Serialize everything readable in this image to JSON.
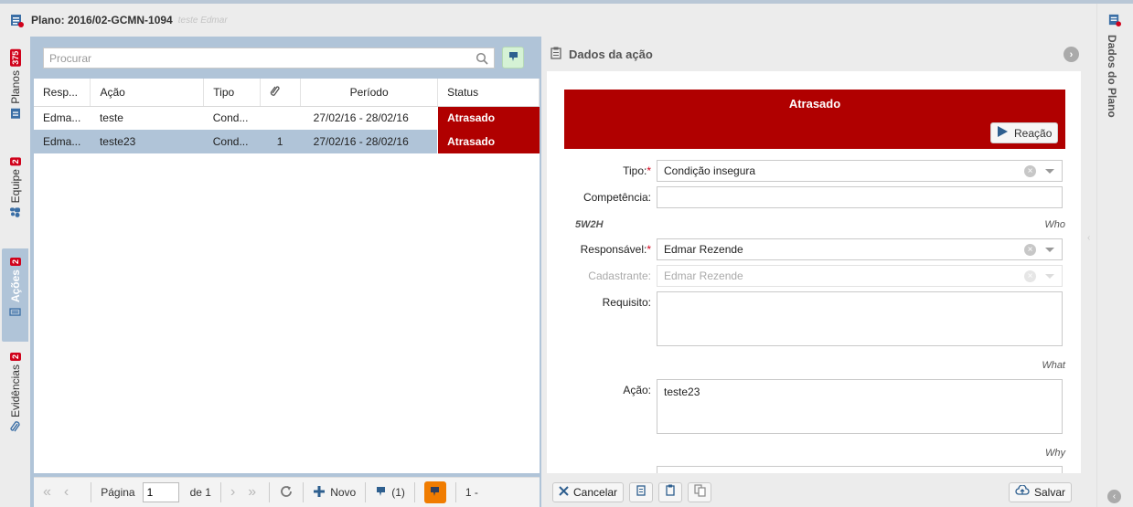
{
  "title": {
    "plan": "Plano: 2016/02-GCMN-1094",
    "subtitle": "teste Edmar"
  },
  "side_tabs": [
    {
      "label": "Planos",
      "badge": "375"
    },
    {
      "label": "Equipe",
      "badge": "2"
    },
    {
      "label": "Ações",
      "badge": "2"
    },
    {
      "label": "Evidências",
      "badge": "2"
    }
  ],
  "search": {
    "placeholder": "Procurar"
  },
  "grid": {
    "columns": [
      "Resp...",
      "Ação",
      "Tipo",
      "",
      "Período",
      "Status"
    ],
    "rows": [
      {
        "resp": "Edma...",
        "acao": "teste",
        "tipo": "Cond...",
        "anexos": "",
        "periodo": "27/02/16 - 28/02/16",
        "status": "Atrasado",
        "selected": false
      },
      {
        "resp": "Edma...",
        "acao": "teste23",
        "tipo": "Cond...",
        "anexos": "1",
        "periodo": "27/02/16 - 28/02/16",
        "status": "Atrasado",
        "selected": true
      }
    ]
  },
  "pager": {
    "page_label": "Página",
    "page_value": "1",
    "of_label": "de 1",
    "new_label": "Novo",
    "feedback_count": "(1)",
    "range": "1 -"
  },
  "form": {
    "header": "Dados da ação",
    "status_banner": "Atrasado",
    "reaction_button": "Reação",
    "tipo_label": "Tipo:",
    "tipo_value": "Condição insegura",
    "competencia_label": "Competência:",
    "competencia_value": "",
    "section_5w2h": "5W2H",
    "section_who": "Who",
    "responsavel_label": "Responsável:",
    "responsavel_value": "Edmar Rezende",
    "cadastrante_label": "Cadastrante:",
    "cadastrante_value": "Edmar Rezende",
    "requisito_label": "Requisito:",
    "requisito_value": "",
    "section_what": "What",
    "acao_label": "Ação:",
    "acao_value": "teste23",
    "section_why": "Why",
    "cancel_label": "Cancelar",
    "save_label": "Salvar"
  },
  "right_panel": {
    "label": "Dados do Plano"
  },
  "colors": {
    "accent": "#b0c4d8",
    "overdue": "#b00000",
    "required": "#d0021b",
    "orange": "#f07c00"
  }
}
